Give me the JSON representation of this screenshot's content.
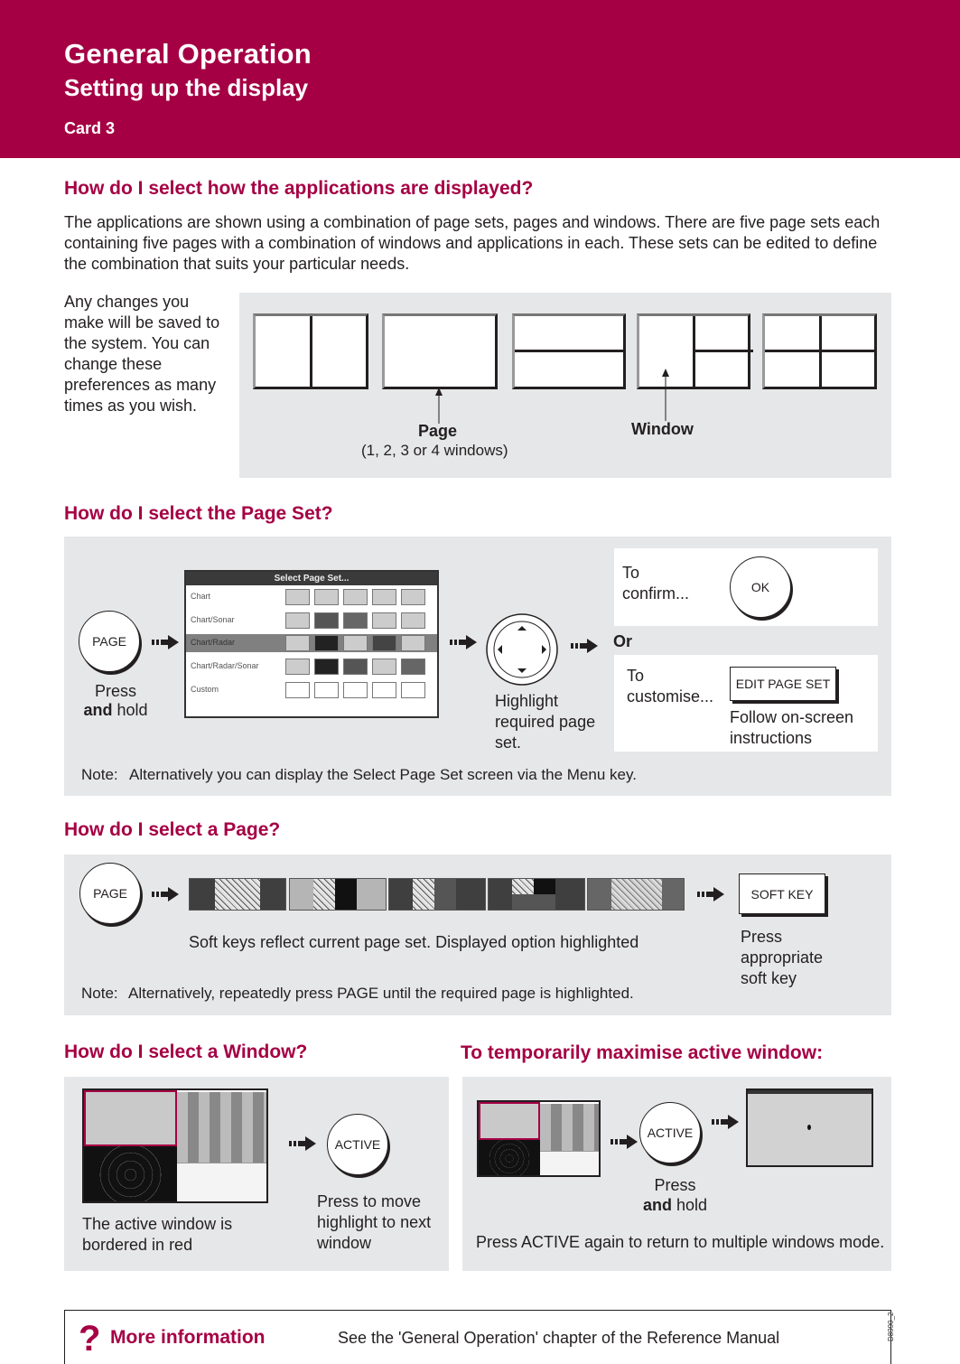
{
  "header": {
    "title": "General Operation",
    "subtitle": "Setting up the display",
    "card": "Card 3"
  },
  "colors": {
    "brand": "#a50044",
    "panel": "#e6e7e8",
    "text": "#231f20"
  },
  "section1": {
    "heading": "How do I select how the applications are displayed?",
    "intro": "The applications are shown using a combination of page sets, pages and windows. There are five page sets each containing five pages with a combination of windows and applications in each.  These sets can be edited to define the combination that suits your particular needs.",
    "side_note": "Any changes you make will be saved to the system. You can change these preferences as many times as you wish.",
    "layouts": [
      "2 windows vertical split",
      "1 window",
      "2 windows horizontal split",
      "3 windows",
      "4 windows"
    ],
    "page_label": "Page",
    "page_sublabel": "(1, 2, 3 or 4 windows)",
    "window_label": "Window"
  },
  "section2": {
    "heading": "How do I select the Page Set?",
    "page_key": "PAGE",
    "press_label": "Press",
    "and_label": "and",
    "hold_label": "hold",
    "screen": {
      "title": "Select Page Set...",
      "rows": [
        "Chart",
        "Chart/Sonar",
        "Chart/Radar",
        "Chart/Radar/Sonar",
        "Custom"
      ],
      "selected": "Chart/Radar"
    },
    "trackpad_caption": "Highlight required page set.",
    "confirm_label": "To confirm...",
    "ok_key": "OK",
    "or_label": "Or",
    "customise_label": "To customise...",
    "edit_key": "EDIT PAGE SET",
    "follow_label": "Follow on-screen instructions",
    "note_label": "Note:",
    "note": "Alternatively you can display the Select Page Set screen via the Menu key."
  },
  "section3": {
    "heading": "How do I select a Page?",
    "page_key": "PAGE",
    "softkeys_caption": "Soft keys reflect current page set.  Displayed option highlighted",
    "soft_key": "SOFT KEY",
    "soft_key_caption": "Press appropriate soft key",
    "note_label": "Note:",
    "note": "Alternatively, repeatedly press PAGE until the required page is highlighted."
  },
  "section4": {
    "heading": "How do I select a Window?",
    "caption": "The active window is bordered in red",
    "active_key": "ACTIVE",
    "key_caption": "Press to move highlight to next window"
  },
  "section5": {
    "heading": "To temporarily maximise active window:",
    "active_key": "ACTIVE",
    "press_label": "Press",
    "and_label": "and",
    "hold_label": "hold",
    "note": "Press ACTIVE again to return to multiple windows mode."
  },
  "footer": {
    "icon": "question-mark-icon",
    "label": "More information",
    "text": "See the 'General Operation' chapter of the Reference Manual",
    "ref_code": "D8990_2"
  }
}
